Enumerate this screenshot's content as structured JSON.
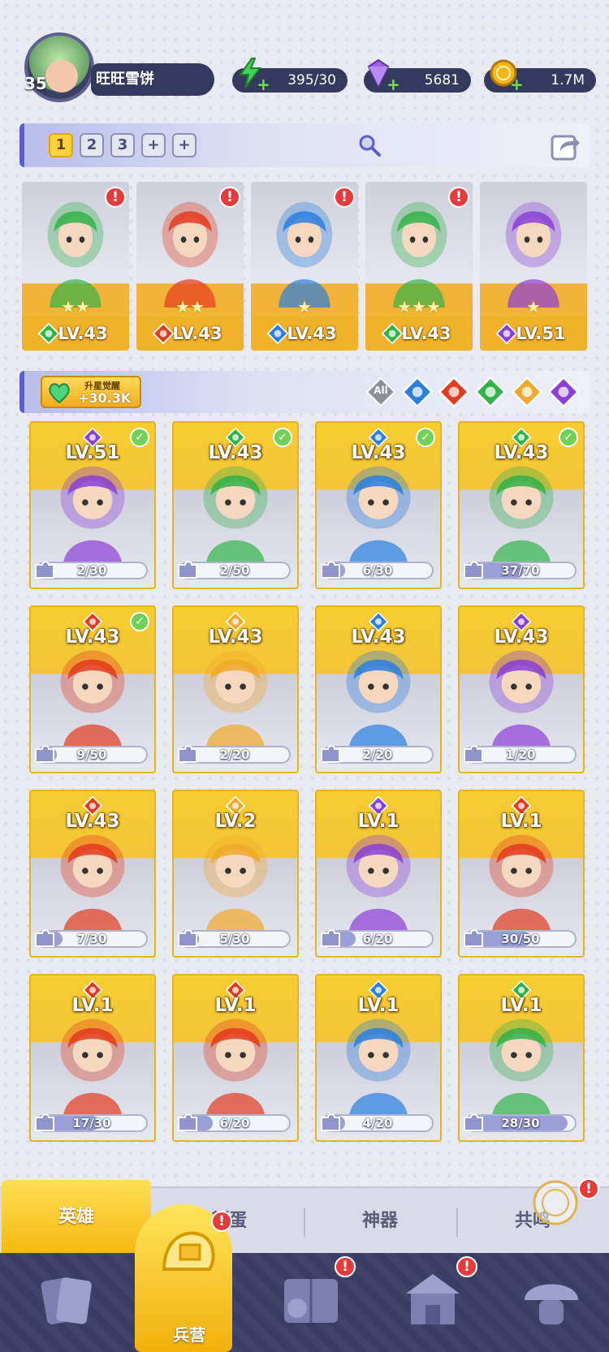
{
  "player": {
    "level": "35",
    "name": "旺旺雪饼"
  },
  "resources": [
    {
      "name": "energy",
      "icon": "lightning-icon",
      "value": "395/30",
      "color": "#3fd35a"
    },
    {
      "name": "gems",
      "icon": "diamond-icon",
      "value": "5681",
      "color": "#9a63e8"
    },
    {
      "name": "coins",
      "icon": "coin-icon",
      "value": "1.7M",
      "color": "#f2b71f"
    }
  ],
  "team_tabs": [
    "1",
    "2",
    "3",
    "+",
    "+"
  ],
  "team": [
    {
      "element": "wind",
      "level": "LV.43",
      "stars": "★★",
      "alert": "!"
    },
    {
      "element": "fire",
      "level": "LV.43",
      "stars": "★★",
      "alert": "!"
    },
    {
      "element": "water",
      "level": "LV.43",
      "stars": "★",
      "alert": "!"
    },
    {
      "element": "wind",
      "level": "LV.43",
      "stars": "★★★",
      "alert": "!"
    },
    {
      "element": "dark",
      "level": "LV.51",
      "stars": "★"
    }
  ],
  "awaken": {
    "label": "升星觉醒",
    "value": "+30.3K"
  },
  "filters": [
    {
      "name": "all",
      "label": "All"
    },
    {
      "name": "water"
    },
    {
      "name": "fire"
    },
    {
      "name": "wind"
    },
    {
      "name": "light"
    },
    {
      "name": "dark"
    }
  ],
  "heroes": [
    {
      "element": "dark",
      "level": "LV.51",
      "shards": "2/30",
      "fill": 0.07,
      "ready": true
    },
    {
      "element": "wind",
      "level": "LV.43",
      "shards": "2/50",
      "fill": 0.04,
      "ready": true
    },
    {
      "element": "water",
      "level": "LV.43",
      "shards": "6/30",
      "fill": 0.2,
      "ready": true
    },
    {
      "element": "wind",
      "level": "LV.43",
      "shards": "37/70",
      "fill": 0.53,
      "ready": true
    },
    {
      "element": "fire",
      "level": "LV.43",
      "shards": "9/50",
      "fill": 0.18,
      "ready": true
    },
    {
      "element": "light",
      "level": "LV.43",
      "shards": "2/20",
      "fill": 0.1
    },
    {
      "element": "water",
      "level": "LV.43",
      "shards": "2/20",
      "fill": 0.1
    },
    {
      "element": "dark",
      "level": "LV.43",
      "shards": "1/20",
      "fill": 0.05
    },
    {
      "element": "fire",
      "level": "LV.43",
      "shards": "7/30",
      "fill": 0.23
    },
    {
      "element": "light",
      "level": "LV.2",
      "shards": "5/30",
      "fill": 0.17
    },
    {
      "element": "dark",
      "level": "LV.1",
      "shards": "6/20",
      "fill": 0.3
    },
    {
      "element": "fire",
      "level": "LV.1",
      "shards": "30/50",
      "fill": 0.6
    },
    {
      "element": "fire",
      "level": "LV.1",
      "shards": "17/30",
      "fill": 0.57
    },
    {
      "element": "fire",
      "level": "LV.1",
      "shards": "6/20",
      "fill": 0.3
    },
    {
      "element": "water",
      "level": "LV.1",
      "shards": "4/20",
      "fill": 0.2
    },
    {
      "element": "wind",
      "level": "LV.1",
      "shards": "28/30",
      "fill": 0.93
    }
  ],
  "subtabs": {
    "heroes": "英雄",
    "hatch": "孵蛋",
    "artifacts": "神器",
    "resonance": "共鸣"
  },
  "nav": {
    "cards": "",
    "barracks": "兵营",
    "book": "",
    "shrine": "",
    "spirit": ""
  },
  "colors": {
    "wind": "#32b34a",
    "fire": "#e33b1f",
    "water": "#2a7fe0",
    "light": "#f0a92a",
    "dark": "#8a3fd6",
    "gold": "#f3b12a",
    "navy": "#35395e"
  }
}
